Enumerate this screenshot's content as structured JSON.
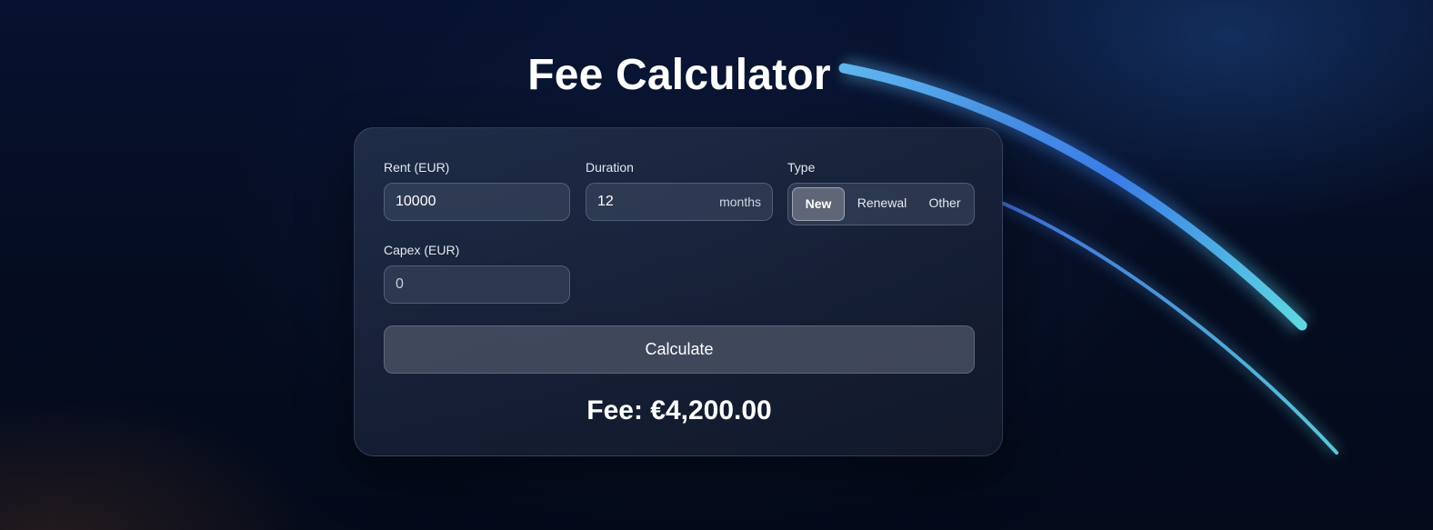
{
  "header": {
    "title": "Fee Calculator"
  },
  "form": {
    "rent": {
      "label": "Rent (EUR)",
      "value": "10000"
    },
    "duration": {
      "label": "Duration",
      "value": "12",
      "suffix": "months"
    },
    "type": {
      "label": "Type",
      "options": [
        "New",
        "Renewal",
        "Other"
      ],
      "selected": "New"
    },
    "capex": {
      "label": "Capex (EUR)",
      "value": "0"
    },
    "calculate_label": "Calculate"
  },
  "result": {
    "text": "Fee: €4,200.00"
  },
  "colors": {
    "background": "#050d22",
    "accent_blue": "#3b7fe6",
    "accent_cyan": "#5fd6e0",
    "card": "#1c2640"
  }
}
